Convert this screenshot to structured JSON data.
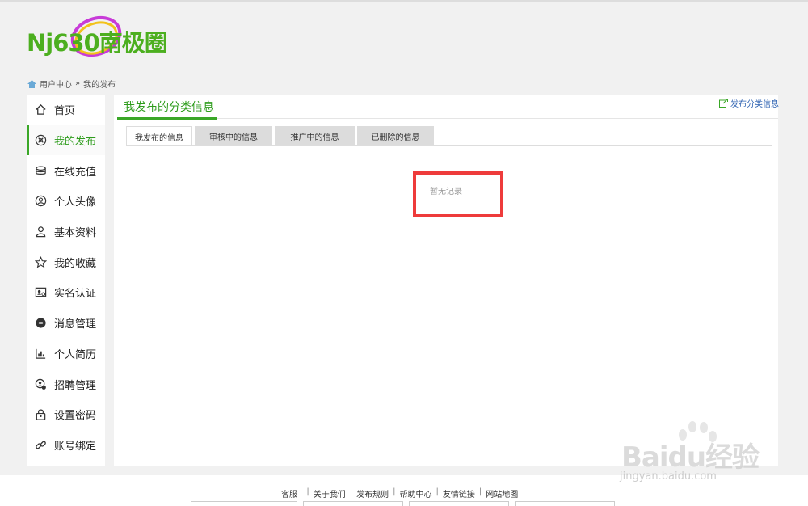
{
  "logo": {
    "text": "Nj630南极圈"
  },
  "breadcrumb": {
    "home": "用户中心",
    "separator": "»",
    "current": "我的发布"
  },
  "sidebar": {
    "items": [
      {
        "label": "首页",
        "icon": "home-icon"
      },
      {
        "label": "我的发布",
        "icon": "grid-icon",
        "active": true
      },
      {
        "label": "在线充值",
        "icon": "coins-icon"
      },
      {
        "label": "个人头像",
        "icon": "avatar-icon"
      },
      {
        "label": "基本资料",
        "icon": "user-icon"
      },
      {
        "label": "我的收藏",
        "icon": "star-icon"
      },
      {
        "label": "实名认证",
        "icon": "id-card-icon"
      },
      {
        "label": "消息管理",
        "icon": "message-icon"
      },
      {
        "label": "个人简历",
        "icon": "resume-icon"
      },
      {
        "label": "招聘管理",
        "icon": "recruit-icon"
      },
      {
        "label": "设置密码",
        "icon": "lock-icon"
      },
      {
        "label": "账号绑定",
        "icon": "link-icon"
      }
    ]
  },
  "main": {
    "title": "我发布的分类信息",
    "publish_link": "发布分类信息",
    "tabs": [
      {
        "label": "我发布的信息",
        "active": true
      },
      {
        "label": "审核中的信息"
      },
      {
        "label": "推广中的信息"
      },
      {
        "label": "已删除的信息"
      }
    ],
    "empty_text": "暂无记录"
  },
  "footer": {
    "links": [
      "客服",
      "关于我们",
      "发布规则",
      "帮助中心",
      "友情链接",
      "网站地图"
    ]
  },
  "watermark": {
    "text": "Baidu经验",
    "sub": "jingyan.baidu.com"
  },
  "colors": {
    "accent": "#3aa727",
    "highlight": "#ee3b3b",
    "link": "#2a5fb0"
  }
}
